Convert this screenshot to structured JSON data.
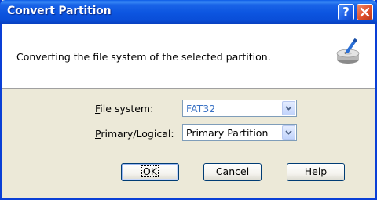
{
  "window": {
    "title": "Convert Partition",
    "help_button": "?",
    "close_button": "X"
  },
  "header": {
    "description": "Converting the file system of the selected partition.",
    "icon": "disk-convert-icon"
  },
  "form": {
    "file_system": {
      "label_accel": "F",
      "label_rest": "ile system:",
      "value": "FAT32",
      "enabled": false
    },
    "primary_logical": {
      "label_accel": "P",
      "label_rest": "rimary/Logical:",
      "value": "Primary Partition",
      "enabled": true
    }
  },
  "buttons": {
    "ok": "OK",
    "cancel_accel": "C",
    "cancel_rest": "ancel",
    "help_accel": "H",
    "help_rest": "elp"
  },
  "colors": {
    "titlebar": "#0a4ed8",
    "dialog_bg": "#ece9d8",
    "close": "#e0502a"
  }
}
